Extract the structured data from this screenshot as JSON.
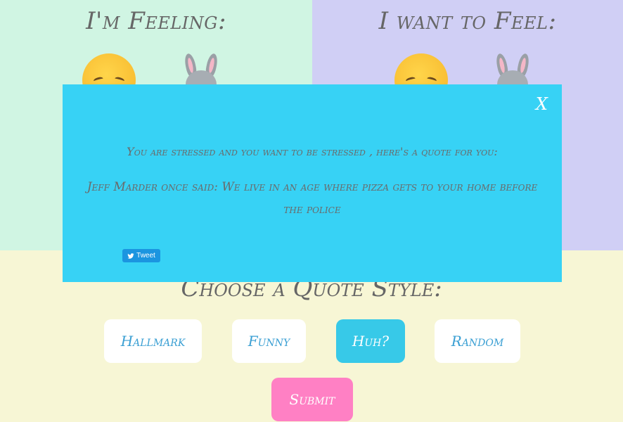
{
  "feeling_panel": {
    "title": "I'm Feeling:",
    "emoji": "sad-face-icon",
    "animal": "bunny-icon"
  },
  "want_panel": {
    "title": "I want to Feel:",
    "emoji": "sad-face-icon",
    "animal": "bunny-icon"
  },
  "quote_style": {
    "title": "Choose a Quote Style:",
    "buttons": [
      {
        "label": "Hallmark",
        "active": false
      },
      {
        "label": "Funny",
        "active": false
      },
      {
        "label": "Huh?",
        "active": true
      },
      {
        "label": "Random",
        "active": false
      }
    ],
    "submit_label": "Submit"
  },
  "modal": {
    "close_label": "X",
    "intro": "You are stressed and you want to be stressed , here's a quote for you:",
    "quote": "Jeff Marder once said: We live in an age where pizza gets to your home before the police",
    "tweet_label": "Tweet"
  },
  "colors": {
    "left_panel": "#d0f5e3",
    "right_panel": "#d0cff5",
    "bottom_panel": "#f7f6d5",
    "modal": "#37d2f5",
    "active_button": "#37c9e8",
    "submit": "#ff80c4",
    "tweet": "#1b95e0"
  }
}
